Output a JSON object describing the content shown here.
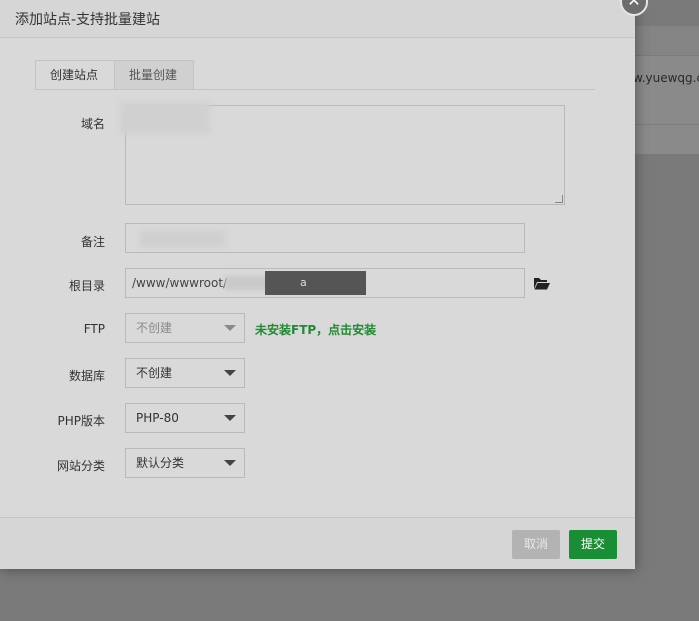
{
  "dialog": {
    "title": "添加站点-支持批量建站",
    "close_glyph": "✕"
  },
  "tabs": [
    {
      "label": "创建站点",
      "active": true
    },
    {
      "label": "批量创建",
      "active": false
    }
  ],
  "form": {
    "domain": {
      "label": "域名",
      "value": ""
    },
    "note": {
      "label": "备注",
      "value": ""
    },
    "root_dir": {
      "label": "根目录",
      "value": "/www/wwwroot/",
      "masked_tail": "a"
    },
    "ftp": {
      "label": "FTP",
      "value": "不创建",
      "tip": "未安装FTP，点击安装"
    },
    "database": {
      "label": "数据库",
      "value": "不创建"
    },
    "php_version": {
      "label": "PHP版本",
      "value": "PHP-80"
    },
    "category": {
      "label": "网站分类",
      "value": "默认分类"
    }
  },
  "footer": {
    "cancel_label": "取消",
    "submit_label": "提交"
  },
  "background": {
    "url_fragment": "w.yuewqg.c"
  },
  "colors": {
    "accent_green": "#1a8e35",
    "tip_green": "#1f8a32"
  },
  "icons": {
    "folder": "folder-open-icon",
    "close": "close-icon",
    "caret": "caret-down-icon"
  }
}
